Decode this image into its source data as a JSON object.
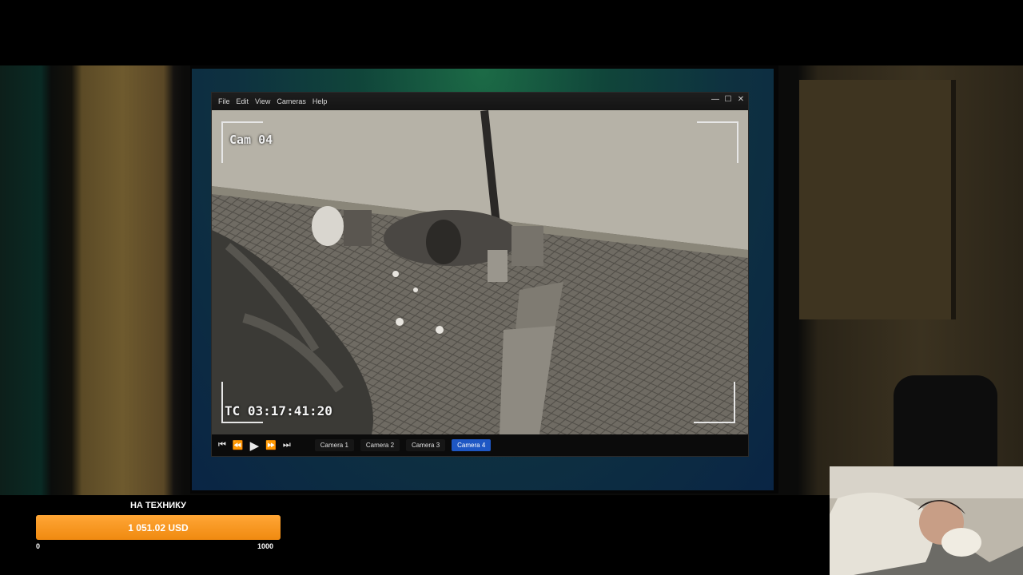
{
  "app": {
    "menu": [
      "File",
      "Edit",
      "View",
      "Cameras",
      "Help"
    ],
    "window_controls": {
      "minimize": "—",
      "maximize": "☐",
      "close": "✕"
    }
  },
  "feed": {
    "camera_label": "Cam 04",
    "timecode": "TC 03:17:41:20"
  },
  "controls": {
    "skip_back": "⏮",
    "rewind": "⏪",
    "play": "▶",
    "fast_forward": "⏩",
    "skip_forward": "⏭"
  },
  "camera_tabs": [
    {
      "label": "Camera 1",
      "active": false
    },
    {
      "label": "Camera 2",
      "active": false
    },
    {
      "label": "Camera 3",
      "active": false
    },
    {
      "label": "Camera 4",
      "active": true
    }
  ],
  "donation": {
    "title": "НА ТЕХНИКУ",
    "amount": "1 051.02 USD",
    "min": "0",
    "max": "1000",
    "progress_fraction": 1.0
  },
  "colors": {
    "accent_orange": "#f08a10",
    "active_tab": "#1e57c4"
  }
}
